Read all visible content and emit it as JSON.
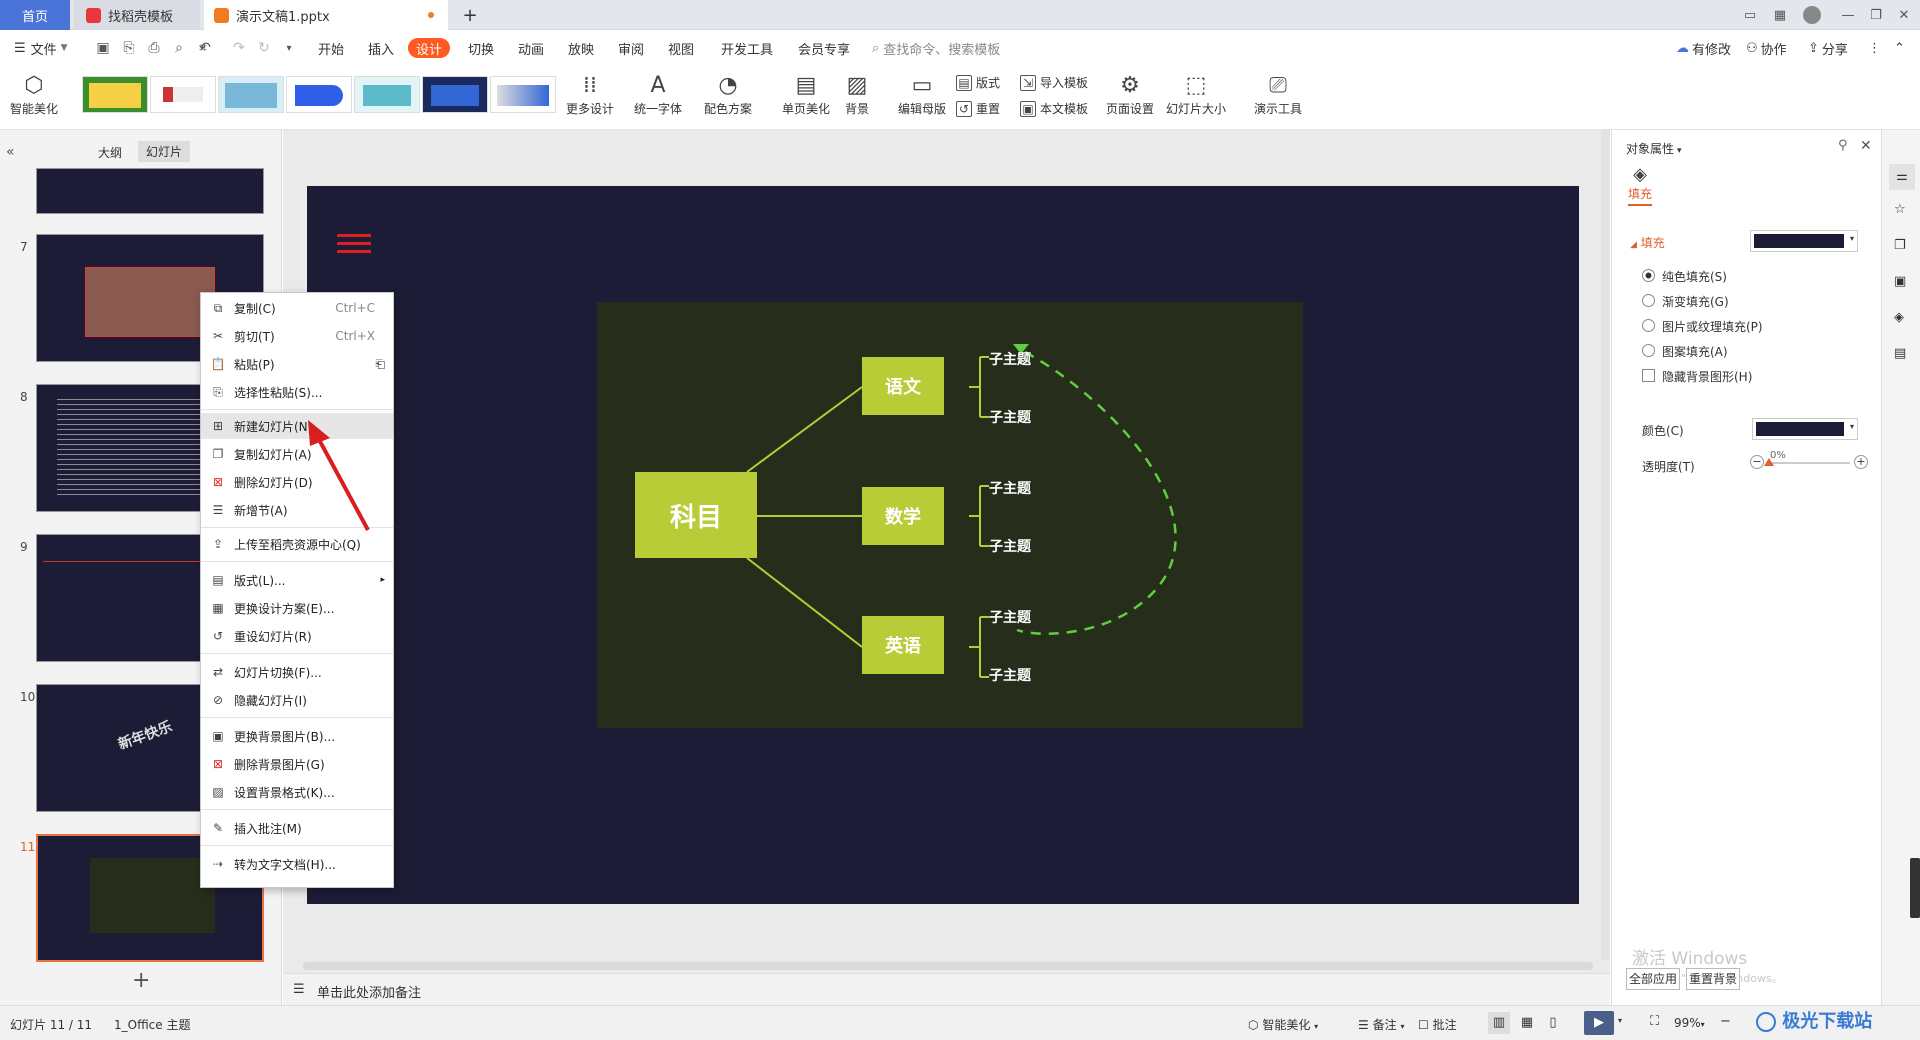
{
  "tabs": {
    "home": "首页",
    "template": "找稻壳模板",
    "document": "演示文稿1.pptx",
    "new_tab": "+"
  },
  "menu": {
    "file": "文件",
    "items": [
      "开始",
      "插入",
      "设计",
      "切换",
      "动画",
      "放映",
      "审阅",
      "视图",
      "开发工具",
      "会员专享"
    ],
    "search_placeholder": "查找命令、搜索模板",
    "has_changes": "有修改",
    "collaborate": "协作",
    "share": "分享"
  },
  "ribbon": {
    "smart_beautify": "智能美化",
    "more_design": "更多设计",
    "unify_font": "统一字体",
    "color_scheme": "配色方案",
    "single_page_beautify": "单页美化",
    "background": "背景",
    "edit_master": "编辑母版",
    "layout": "版式",
    "reset": "重置",
    "import_template": "导入模板",
    "this_template": "本文模板",
    "page_setup": "页面设置",
    "slide_size": "幻灯片大小",
    "presentation_tools": "演示工具"
  },
  "left_panel": {
    "outline_tab": "大纲",
    "slides_tab": "幻灯片",
    "slide_numbers": [
      "7",
      "8",
      "9",
      "10",
      "11"
    ],
    "slide10_text": "新年快乐",
    "add_button": "+"
  },
  "context_menu": {
    "items": [
      {
        "label": "复制(C)",
        "shortcut": "Ctrl+C"
      },
      {
        "label": "剪切(T)",
        "shortcut": "Ctrl+X"
      },
      {
        "label": "粘贴(P)",
        "shortcut": ""
      },
      {
        "label": "选择性粘贴(S)...",
        "shortcut": ""
      },
      {
        "label": "新建幻灯片(N)",
        "shortcut": ""
      },
      {
        "label": "复制幻灯片(A)",
        "shortcut": ""
      },
      {
        "label": "删除幻灯片(D)",
        "shortcut": ""
      },
      {
        "label": "新增节(A)",
        "shortcut": ""
      },
      {
        "label": "上传至稻壳资源中心(Q)",
        "shortcut": ""
      },
      {
        "label": "版式(L)...",
        "shortcut": ""
      },
      {
        "label": "更换设计方案(E)...",
        "shortcut": ""
      },
      {
        "label": "重设幻灯片(R)",
        "shortcut": ""
      },
      {
        "label": "幻灯片切换(F)...",
        "shortcut": ""
      },
      {
        "label": "隐藏幻灯片(I)",
        "shortcut": ""
      },
      {
        "label": "更换背景图片(B)...",
        "shortcut": ""
      },
      {
        "label": "删除背景图片(G)",
        "shortcut": ""
      },
      {
        "label": "设置背景格式(K)...",
        "shortcut": ""
      },
      {
        "label": "插入批注(M)",
        "shortcut": ""
      },
      {
        "label": "转为文字文档(H)...",
        "shortcut": ""
      }
    ]
  },
  "slide": {
    "root": "科目",
    "branches": [
      "语文",
      "数学",
      "英语"
    ],
    "leaf": "子主题"
  },
  "notes_placeholder": "单击此处添加备注",
  "right_panel": {
    "title": "对象属性",
    "fill_tab": "填充",
    "fill_section": "填充",
    "options": [
      "纯色填充(S)",
      "渐变填充(G)",
      "图片或纹理填充(P)",
      "图案填充(A)"
    ],
    "hide_bg": "隐藏背景图形(H)",
    "color_label": "颜色(C)",
    "transparency_label": "透明度(T)",
    "transparency_value": "0%",
    "apply_all": "全部应用",
    "reset_bg": "重置背景",
    "watermark1": "激活 Windows",
    "watermark2": "转到\"设置\"以激活 Windows。",
    "fill_color": "#1c1c36"
  },
  "status": {
    "slide_info": "幻灯片 11 / 11",
    "theme": "1_Office 主题",
    "smart_beautify": "智能美化",
    "notes": "备注",
    "comments": "批注",
    "zoom": "99%",
    "site_watermark": "极光下载站"
  },
  "colors": {
    "accent": "#ff5a1f",
    "mindmap_green": "#b7cc37",
    "slide_bg": "#1c1c36",
    "mindmap_bg": "#262d1b"
  }
}
